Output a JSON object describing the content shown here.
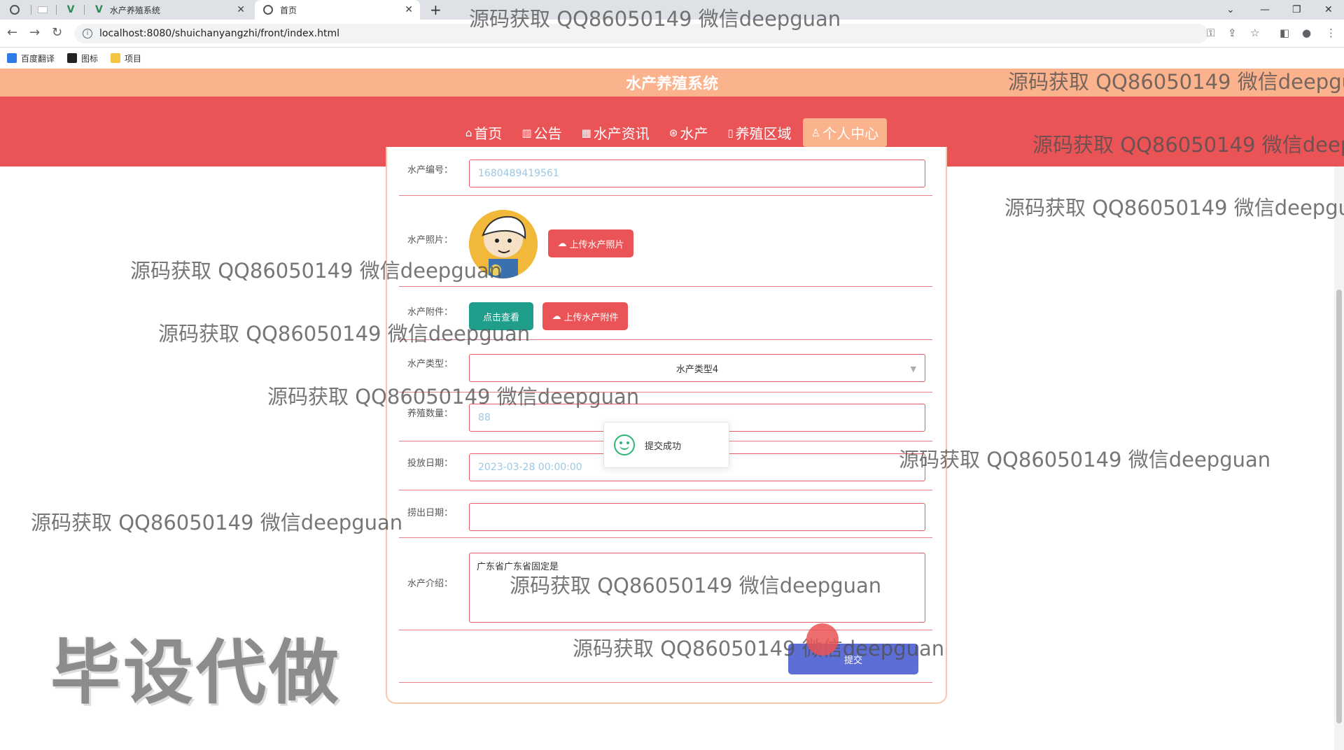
{
  "browser": {
    "tabs": [
      {
        "title": "水产养殖系统"
      },
      {
        "title": "首页"
      }
    ],
    "url": "localhost:8080/shuichanyangzhi/front/index.html",
    "bookmarks": [
      "百度翻译",
      "图标",
      "项目"
    ]
  },
  "site": {
    "title": "水产养殖系统",
    "nav": [
      {
        "icon": "⌂",
        "label": "首页"
      },
      {
        "icon": "▥",
        "label": "公告"
      },
      {
        "icon": "▦",
        "label": "水产资讯"
      },
      {
        "icon": "⊛",
        "label": "水产"
      },
      {
        "icon": "▯",
        "label": "养殖区域"
      },
      {
        "icon": "♙",
        "label": "个人中心"
      }
    ]
  },
  "form": {
    "code_label": "水产编号：",
    "code_value": "1680489419561",
    "photo_label": "水产照片：",
    "upload_photo": "上传水产照片",
    "attachment_label": "水产附件：",
    "view_button": "点击查看",
    "upload_attachment": "上传水产附件",
    "type_label": "水产类型：",
    "type_value": "水产类型4",
    "quantity_label": "养殖数量：",
    "quantity_value": "88",
    "release_label": "投放日期：",
    "release_value": "2023-03-28 00:00:00",
    "catch_label": "捞出日期：",
    "catch_value": "",
    "intro_label": "水产介绍：",
    "intro_value": "广东省广东省固定是",
    "submit": "提交"
  },
  "toast": {
    "message": "提交成功"
  },
  "overlay": {
    "watermark": "源码获取 QQ86050149 微信deepguan",
    "banner": "毕设代做"
  }
}
